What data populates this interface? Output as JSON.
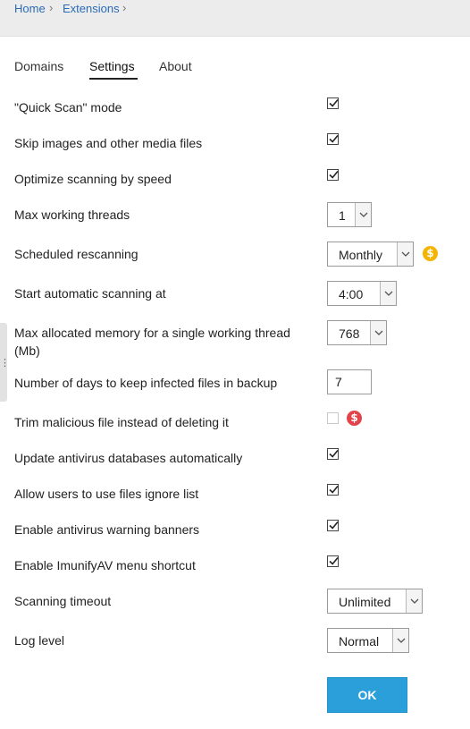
{
  "breadcrumb": {
    "home": "Home",
    "extensions": "Extensions"
  },
  "tabs": [
    {
      "label": "Domains"
    },
    {
      "label": "Settings",
      "active": true
    },
    {
      "label": "About"
    }
  ],
  "settings": {
    "quick_scan": {
      "label": "\"Quick Scan\" mode",
      "checked": true
    },
    "skip_media": {
      "label": "Skip images and other media files",
      "checked": true
    },
    "optimize_speed": {
      "label": "Optimize scanning by speed",
      "checked": true
    },
    "max_threads": {
      "label": "Max working threads",
      "value": "1"
    },
    "rescanning": {
      "label": "Scheduled rescanning",
      "value": "Monthly",
      "premium_icon": "dollar-coin-icon"
    },
    "start_at": {
      "label": "Start automatic scanning at",
      "value": "4:00"
    },
    "max_memory": {
      "label_line1": "Max allocated memory for a single working thread",
      "label_line2": "(Mb)",
      "value": "768"
    },
    "backup_days": {
      "label": "Number of days to keep infected files in backup",
      "value": "7"
    },
    "trim_malicious": {
      "label": "Trim malicious file instead of deleting it",
      "checked": false,
      "disabled": true,
      "premium_icon": "dollar-coin-icon"
    },
    "update_db": {
      "label": "Update antivirus databases automatically",
      "checked": true
    },
    "ignore_list": {
      "label": "Allow users to use files ignore list",
      "checked": true
    },
    "warning_banners": {
      "label": "Enable antivirus warning banners",
      "checked": true
    },
    "menu_shortcut": {
      "label": "Enable ImunifyAV menu shortcut",
      "checked": true
    },
    "timeout": {
      "label": "Scanning timeout",
      "value": "Unlimited"
    },
    "log_level": {
      "label": "Log level",
      "value": "Normal"
    }
  },
  "ok_button": {
    "label": "OK"
  },
  "colors": {
    "link": "#2a6bb7",
    "ok": "#2b9fd9",
    "gold_coin": "#f4b400",
    "red_coin": "#e3434b"
  }
}
